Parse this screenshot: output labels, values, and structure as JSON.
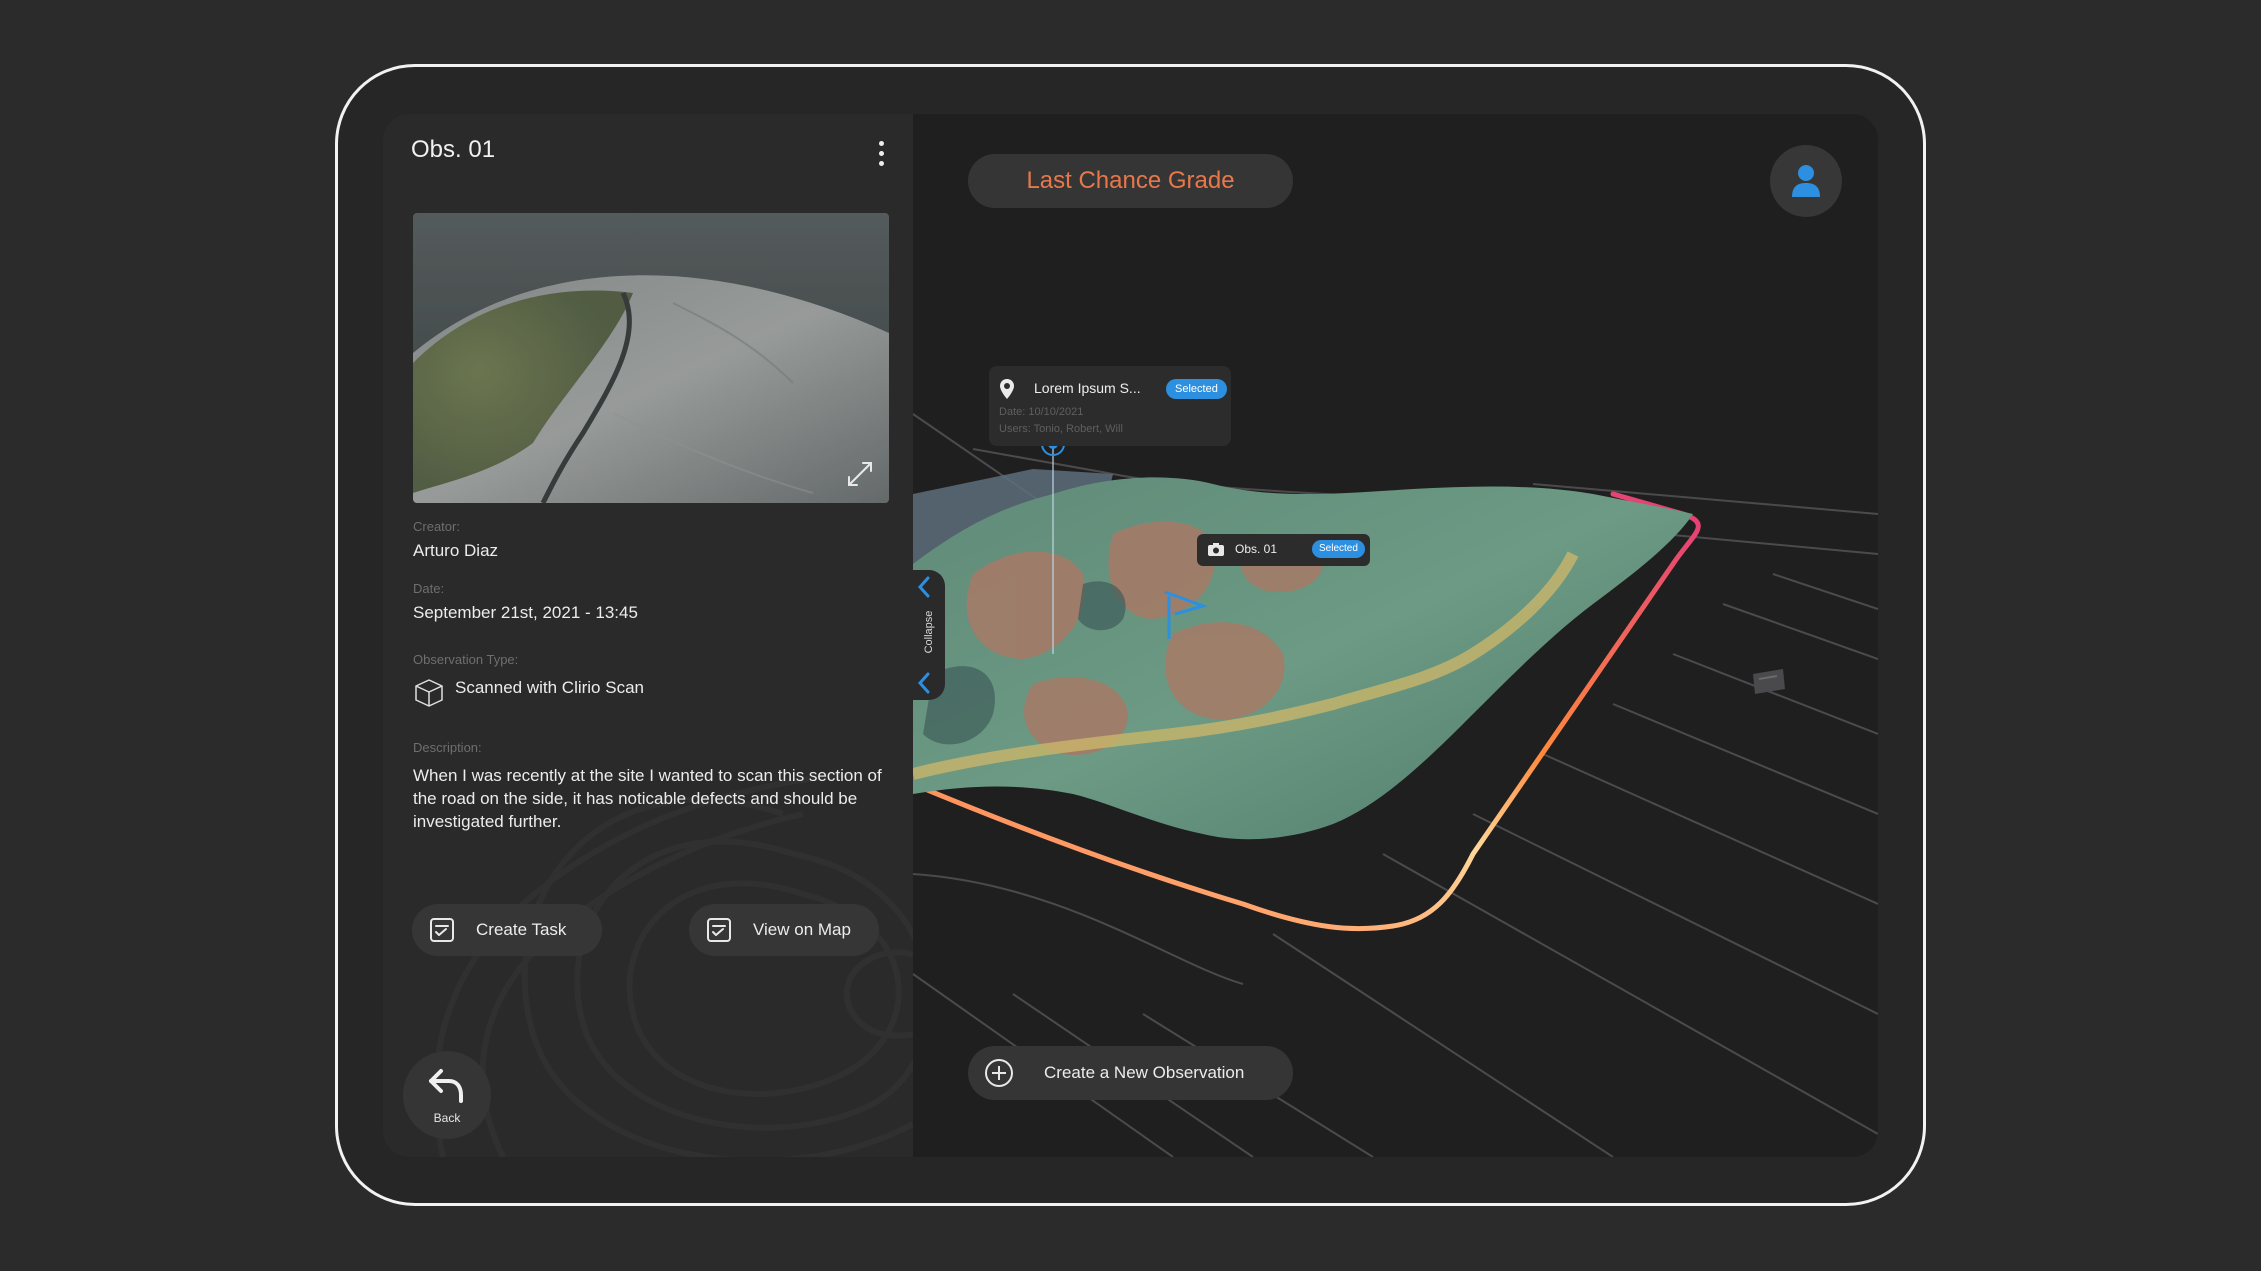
{
  "observation": {
    "title": "Obs. 01",
    "creator_label": "Creator:",
    "creator": "Arturo Diaz",
    "date_label": "Date:",
    "date": "September 21st, 2021 - 13:45",
    "type_label": "Observation Type:",
    "type": "Scanned with Clirio Scan",
    "description_label": "Description:",
    "description": "When I was recently at the site I wanted to scan this section of the road on the side, it has noticable defects and should be investigated further."
  },
  "actions": {
    "create_task": "Create Task",
    "view_on_map": "View on Map",
    "back": "Back"
  },
  "map": {
    "project_name": "Last Chance Grade",
    "collapse_label": "Collapse",
    "new_observation": "Create a New Observation",
    "popup_location": {
      "name": "Lorem Ipsum S...",
      "badge": "Selected",
      "date": "Date: 10/10/2021",
      "users": "Users: Tonio, Robert, Will"
    },
    "popup_obs": {
      "name": "Obs. 01",
      "badge": "Selected"
    }
  },
  "colors": {
    "accent_orange": "#e8784a",
    "selected_blue": "#2d8fe0",
    "panel_bg": "#2a2a2b"
  },
  "icons": [
    "kebab-menu-icon",
    "expand-icon",
    "cube-icon",
    "task-icon",
    "map-check-icon",
    "back-arrow-icon",
    "user-icon",
    "chevron-left-icon",
    "location-pin-icon",
    "camera-icon",
    "flag-icon",
    "plus-circle-icon"
  ]
}
